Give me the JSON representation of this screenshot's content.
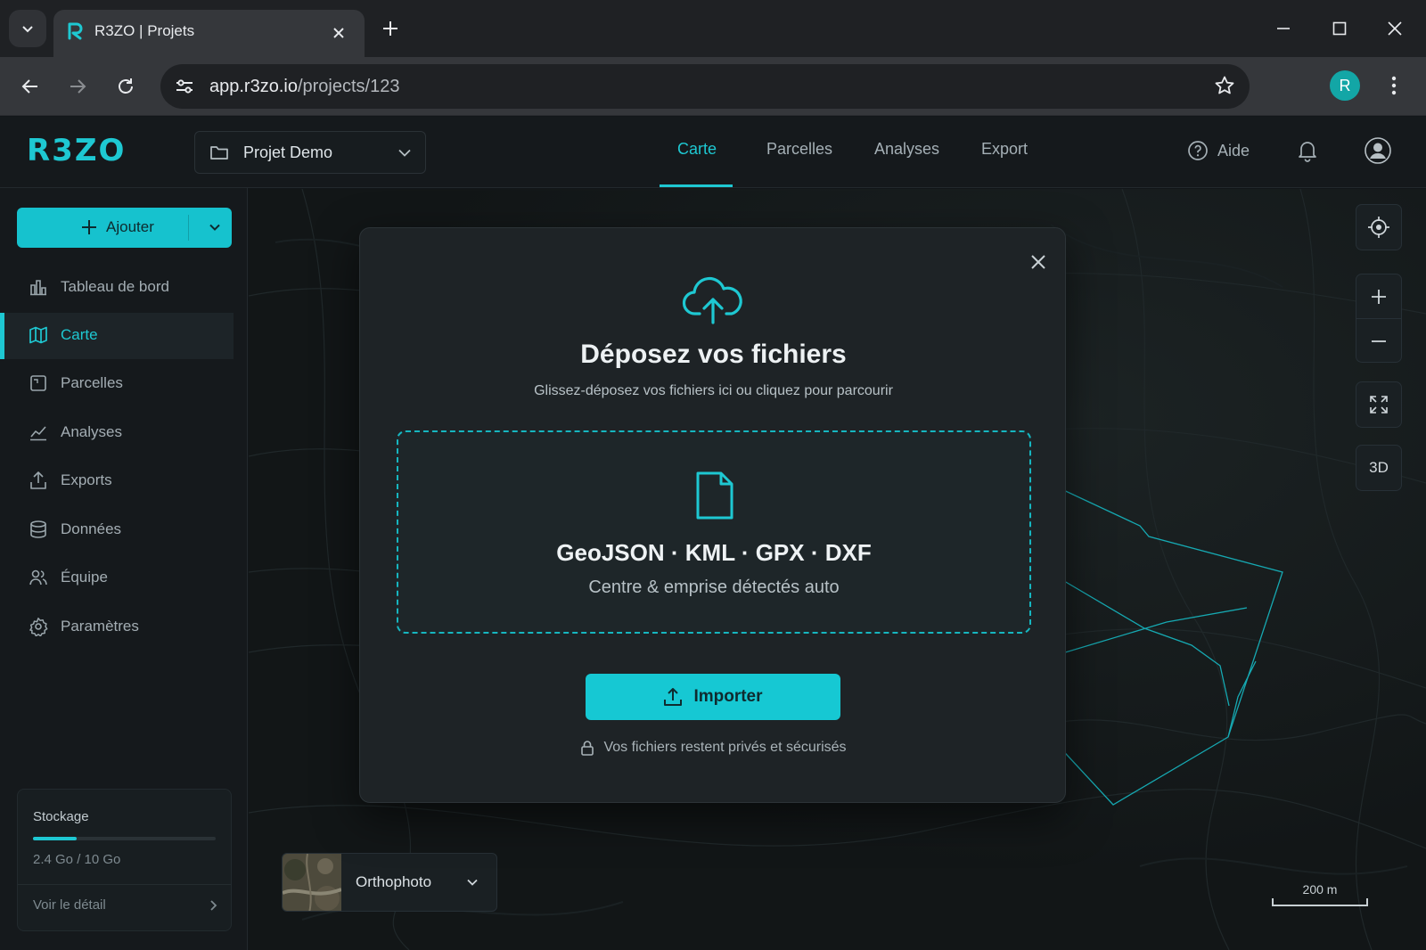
{
  "browser": {
    "tab_title": "R3ZO | Projets",
    "url_host": "app.r3zo.io",
    "url_path": "/projects/123",
    "profile_initial": "R"
  },
  "header": {
    "logo": "R3ZO",
    "project": "Projet Demo",
    "tabs": [
      {
        "label": "Carte",
        "active": true
      },
      {
        "label": "Parcelles",
        "active": false
      },
      {
        "label": "Analyses",
        "active": false
      },
      {
        "label": "Export",
        "active": false
      }
    ],
    "help": "Aide"
  },
  "sidebar": {
    "add_label": "Ajouter",
    "items": [
      {
        "label": "Tableau de bord",
        "icon": "dashboard-icon"
      },
      {
        "label": "Carte",
        "icon": "map-icon",
        "active": true
      },
      {
        "label": "Parcelles",
        "icon": "parcel-icon"
      },
      {
        "label": "Analyses",
        "icon": "chart-icon"
      },
      {
        "label": "Exports",
        "icon": "export-icon"
      },
      {
        "label": "Données",
        "icon": "database-icon"
      },
      {
        "label": "Équipe",
        "icon": "team-icon"
      },
      {
        "label": "Paramètres",
        "icon": "settings-icon"
      }
    ],
    "storage": {
      "title": "Stockage",
      "used": "2.4 Go / 10 Go",
      "used_fraction": 0.24,
      "detail": "Voir le détail"
    }
  },
  "map": {
    "controls": {
      "three_d": "3D"
    },
    "basemap": "Orthophoto",
    "scale": "200 m"
  },
  "modal": {
    "title": "Déposez vos fichiers",
    "subtitle": "Glissez-déposez vos fichiers ici ou cliquez pour parcourir",
    "formats": "GeoJSON · KML · GPX · DXF",
    "hint": "Centre & emprise détectés auto",
    "import_label": "Importer",
    "privacy": "Vos fichiers restent privés et sécurisés"
  },
  "colors": {
    "accent": "#1ec8d2",
    "background": "#121619",
    "modal": "#1e2326"
  }
}
